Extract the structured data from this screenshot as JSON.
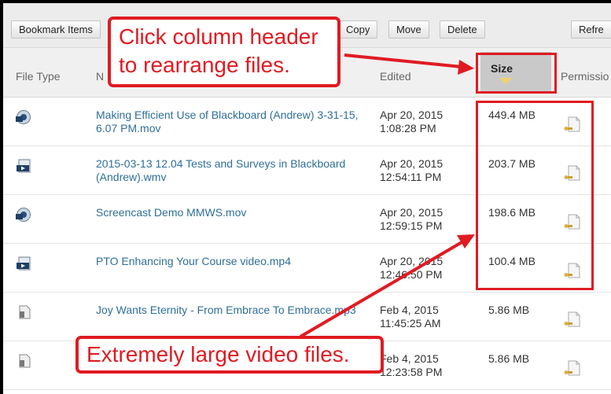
{
  "toolbar": {
    "bookmark_label": "Bookmark Items",
    "copy_label": "Copy",
    "move_label": "Move",
    "delete_label": "Delete",
    "refresh_label": "Refre"
  },
  "columns": {
    "file_type": "File Type",
    "name": "N",
    "edited": "Edited",
    "size": "Size",
    "permissions": "Permissio"
  },
  "rows": [
    {
      "name": "Making Efficient Use of Blackboard (Andrew) 3-31-15, 6.07 PM.mov",
      "date": "Apr 20, 2015",
      "time": "1:08:28 PM",
      "size": "449.4 MB",
      "type_icon": "quicktime-video-icon"
    },
    {
      "name": "2015-03-13 12.04 Tests and Surveys in Blackboard (Andrew).wmv",
      "date": "Apr 20, 2015",
      "time": "12:54:11 PM",
      "size": "203.7 MB",
      "type_icon": "video-file-icon"
    },
    {
      "name": "Screencast Demo MMWS.mov",
      "date": "Apr 20, 2015",
      "time": "12:59:15 PM",
      "size": "198.6 MB",
      "type_icon": "quicktime-video-icon"
    },
    {
      "name": "PTO Enhancing Your Course video.mp4",
      "date": "Apr 20, 2015",
      "time": "12:46:50 PM",
      "size": "100.4 MB",
      "type_icon": "video-file-icon"
    },
    {
      "name": "Joy Wants Eternity - From Embrace To Embrace.mp3",
      "date": "Feb 4, 2015",
      "time": "11:45:25 AM",
      "size": "5.86 MB",
      "type_icon": "audio-file-icon"
    },
    {
      "name": "",
      "date": "Feb 4, 2015",
      "time": "12:23:58 PM",
      "size": "5.86 MB",
      "type_icon": "audio-file-icon"
    }
  ],
  "annotations": {
    "top_callout_line1": "Click column header",
    "top_callout_line2": "to rearrange files.",
    "bottom_callout": "Extremely large video files."
  },
  "colors": {
    "accent_red": "#e01b22",
    "link_blue": "#2f6f99",
    "sort_arrow": "#f3d26b"
  }
}
